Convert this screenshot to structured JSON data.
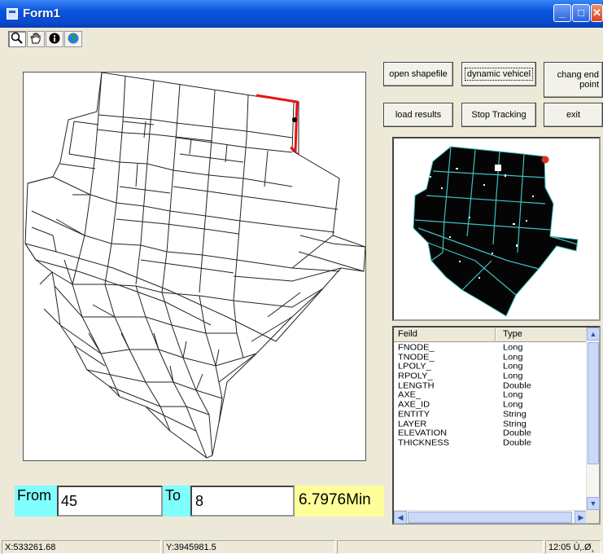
{
  "window": {
    "title": "Form1"
  },
  "toolbar": {
    "tools": [
      "zoom-tool",
      "pan-tool",
      "identify-tool",
      "globe-tool"
    ]
  },
  "buttons": {
    "open_shapefile": "open shapefile",
    "dynamic_vehicle": "dynamic vehicel",
    "change_end_point": "chang end point",
    "load_results": "load results",
    "stop_tracking": "Stop Tracking",
    "exit": "exit"
  },
  "fields_list": {
    "columns": [
      "Feild",
      "Type"
    ],
    "rows": [
      [
        "FNODE_",
        "Long"
      ],
      [
        "TNODE_",
        "Long"
      ],
      [
        "LPOLY_",
        "Long"
      ],
      [
        "RPOLY_",
        "Long"
      ],
      [
        "LENGTH",
        "Double"
      ],
      [
        "AXE_",
        "Long"
      ],
      [
        "AXE_ID",
        "Long"
      ],
      [
        "ENTITY",
        "String"
      ],
      [
        "LAYER",
        "String"
      ],
      [
        "ELEVATION",
        "Double"
      ],
      [
        "THICKNESS",
        "Double"
      ]
    ]
  },
  "route": {
    "from_label": "From",
    "from_value": "45",
    "to_label": "To",
    "to_value": "8",
    "result": "6.7976Min"
  },
  "status": {
    "x": "X:533261.68",
    "y": "Y:3945981.5",
    "middle": "",
    "time": "12:05 Ù‚.Ø¸"
  },
  "colors": {
    "route": "#ee1111",
    "overview_streets": "#40c0c0",
    "label_bg": "#80ffff",
    "result_bg": "#ffff99"
  }
}
